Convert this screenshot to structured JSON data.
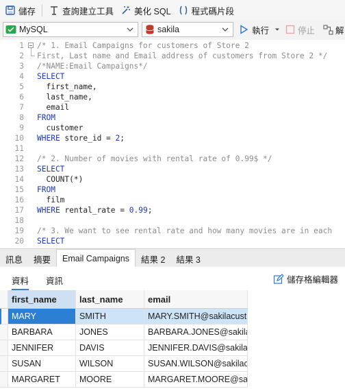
{
  "toolbar": {
    "save": "儲存",
    "query_builder": "查詢建立工具",
    "beautify": "美化 SQL",
    "snippet": "程式碼片段"
  },
  "connection": {
    "value": "MySQL",
    "color": "#2aa84a"
  },
  "database": {
    "value": "sakila",
    "color": "#c0392b"
  },
  "actions": {
    "run": "執行",
    "stop": "停止",
    "explain": "解"
  },
  "editor": {
    "lines": [
      {
        "n": "1",
        "parts": [
          {
            "t": "/* 1. Email Campaigns for customers of Store 2",
            "c": "cm"
          }
        ]
      },
      {
        "n": "2",
        "parts": [
          {
            "t": "First, Last name and Email address of customers from Store 2 */",
            "c": "cm"
          }
        ]
      },
      {
        "n": "3",
        "parts": [
          {
            "t": "/*NAME:Email Campaigns*/",
            "c": "cm"
          }
        ]
      },
      {
        "n": "4",
        "parts": [
          {
            "t": "SELECT",
            "c": "kw"
          }
        ]
      },
      {
        "n": "5",
        "parts": [
          {
            "t": "  first_name,",
            "c": "id"
          }
        ]
      },
      {
        "n": "6",
        "parts": [
          {
            "t": "  last_name,",
            "c": "id"
          }
        ]
      },
      {
        "n": "7",
        "parts": [
          {
            "t": "  email",
            "c": "id"
          }
        ]
      },
      {
        "n": "8",
        "parts": [
          {
            "t": "FROM",
            "c": "kw"
          }
        ]
      },
      {
        "n": "9",
        "parts": [
          {
            "t": "  customer",
            "c": "id"
          }
        ]
      },
      {
        "n": "10",
        "parts": [
          {
            "t": "WHERE",
            "c": "kw"
          },
          {
            "t": " store_id = ",
            "c": "id"
          },
          {
            "t": "2",
            "c": "num"
          },
          {
            "t": ";",
            "c": "id"
          }
        ]
      },
      {
        "n": "11",
        "parts": []
      },
      {
        "n": "12",
        "parts": [
          {
            "t": "/* 2. Number of movies with rental rate of 0.99$ */",
            "c": "cm"
          }
        ]
      },
      {
        "n": "13",
        "parts": [
          {
            "t": "SELECT",
            "c": "kw"
          }
        ]
      },
      {
        "n": "14",
        "parts": [
          {
            "t": "  COUNT(*)",
            "c": "id"
          }
        ]
      },
      {
        "n": "15",
        "parts": [
          {
            "t": "FROM",
            "c": "kw"
          }
        ]
      },
      {
        "n": "16",
        "parts": [
          {
            "t": "  film",
            "c": "id"
          }
        ]
      },
      {
        "n": "17",
        "parts": [
          {
            "t": "WHERE",
            "c": "kw"
          },
          {
            "t": " rental_rate = ",
            "c": "id"
          },
          {
            "t": "0.99",
            "c": "num"
          },
          {
            "t": ";",
            "c": "id"
          }
        ]
      },
      {
        "n": "18",
        "parts": []
      },
      {
        "n": "19",
        "parts": [
          {
            "t": "/* 3. We want to see rental rate and how many movies are in each",
            "c": "cm"
          }
        ]
      },
      {
        "n": "20",
        "parts": [
          {
            "t": "SELECT",
            "c": "kw"
          }
        ]
      }
    ]
  },
  "result_tabs": [
    "訊息",
    "摘要",
    "Email Campaigns",
    "結果 2",
    "結果 3"
  ],
  "subtabs": {
    "data": "資料",
    "info": "資訊",
    "form_editor": "儲存格編輯器"
  },
  "grid": {
    "columns": [
      "first_name",
      "last_name",
      "email"
    ],
    "rows": [
      [
        "MARY",
        "SMITH",
        "MARY.SMITH@sakilacust"
      ],
      [
        "BARBARA",
        "JONES",
        "BARBARA.JONES@sakila"
      ],
      [
        "JENNIFER",
        "DAVIS",
        "JENNIFER.DAVIS@sakilac"
      ],
      [
        "SUSAN",
        "WILSON",
        "SUSAN.WILSON@sakilac"
      ],
      [
        "MARGARET",
        "MOORE",
        "MARGARET.MOORE@sa"
      ]
    ]
  }
}
